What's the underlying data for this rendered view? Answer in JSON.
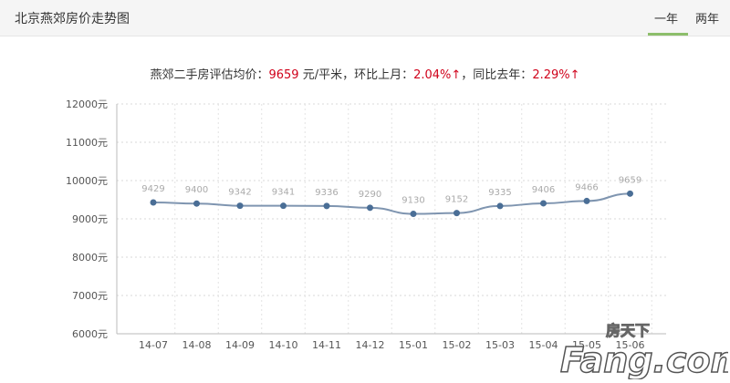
{
  "header": {
    "title": "北京燕郊房价走势图",
    "tabs": [
      {
        "label": "一年",
        "active": true
      },
      {
        "label": "两年",
        "active": false
      }
    ]
  },
  "summary": {
    "prefix": "燕郊二手房评估均价：",
    "price": "9659",
    "unit": " 元/平米，环比上月：",
    "mom": "2.04%↑",
    "mid": "，同比去年：",
    "yoy": "2.29%↑"
  },
  "colors": {
    "accent_tab": "#8dbe6b",
    "up_red": "#d0021b",
    "line": "#7f95b0",
    "point": "#4a6e96"
  },
  "chart_data": {
    "type": "line",
    "categories": [
      "14-07",
      "14-08",
      "14-09",
      "14-10",
      "14-11",
      "14-12",
      "15-01",
      "15-02",
      "15-03",
      "15-04",
      "15-05",
      "15-06"
    ],
    "values": [
      9429,
      9400,
      9342,
      9341,
      9336,
      9290,
      9130,
      9152,
      9335,
      9406,
      9466,
      9659
    ],
    "y_ticks": [
      "12000元",
      "11000元",
      "10000元",
      "9000元",
      "8000元",
      "7000元",
      "6000元"
    ],
    "ylim": [
      6000,
      12000
    ],
    "grid": true
  },
  "watermark": {
    "brand_cn": "房天下",
    "brand_en": "Fang.com"
  }
}
